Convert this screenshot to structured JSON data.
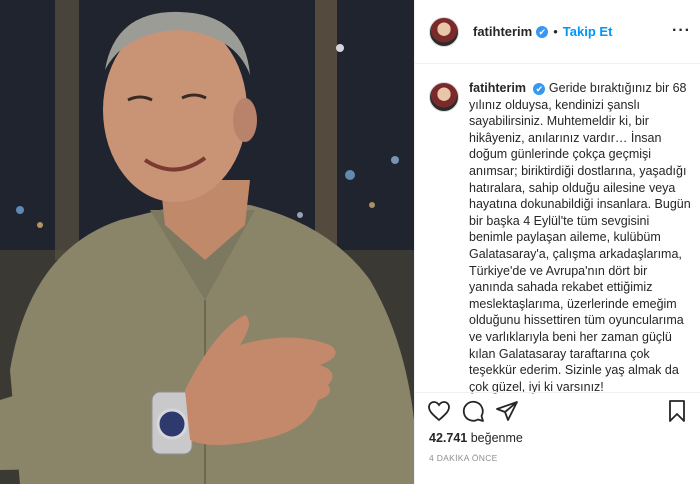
{
  "post": {
    "username": "fatihterim",
    "follow_label": "Takip Et",
    "separator": "•",
    "more_label": "···",
    "verified_mark": "✔",
    "caption": "Geride bıraktığınız bir 68 yılınız olduysa, kendinizi şanslı sayabilirsiniz. Muhtemeldir ki, bir hikâyeniz, anılarınız vardır… İnsan doğum günlerinde çokça geçmişi anımsar; biriktirdiği dostlarına, yaşadığı hatıralara, sahip olduğu ailesine veya hayatına dokunabildiği insanlara. Bugün bir başka 4 Eylül'te tüm sevgisini benimle paylaşan aileme, kulübüm Galatasaray'a, çalışma arkadaşlarıma, Türkiye'de ve Avrupa'nın dört bir yanında sahada rekabet ettiğimiz meslektaşlarıma, üzerlerinde emeğim olduğunu hissettiren tüm oyuncularıma ve varlıklarıyla beni her zaman güçlü kılan Galatasaray taraftarına çok teşekkür ederim. Sizinle yaş almak da çok güzel, iyi ki varsınız!",
    "likes_count": "42.741",
    "likes_label": "beğenme",
    "time_ago": "4 DAKİKA ÖNCE"
  },
  "icons": {
    "like": "heart-icon",
    "comment": "comment-icon",
    "share": "share-icon",
    "save": "bookmark-icon",
    "verified": "verified-badge-icon"
  },
  "colors": {
    "accent": "#0095f6",
    "verified": "#3897f0",
    "text": "#262626",
    "muted": "#8e8e8e"
  }
}
